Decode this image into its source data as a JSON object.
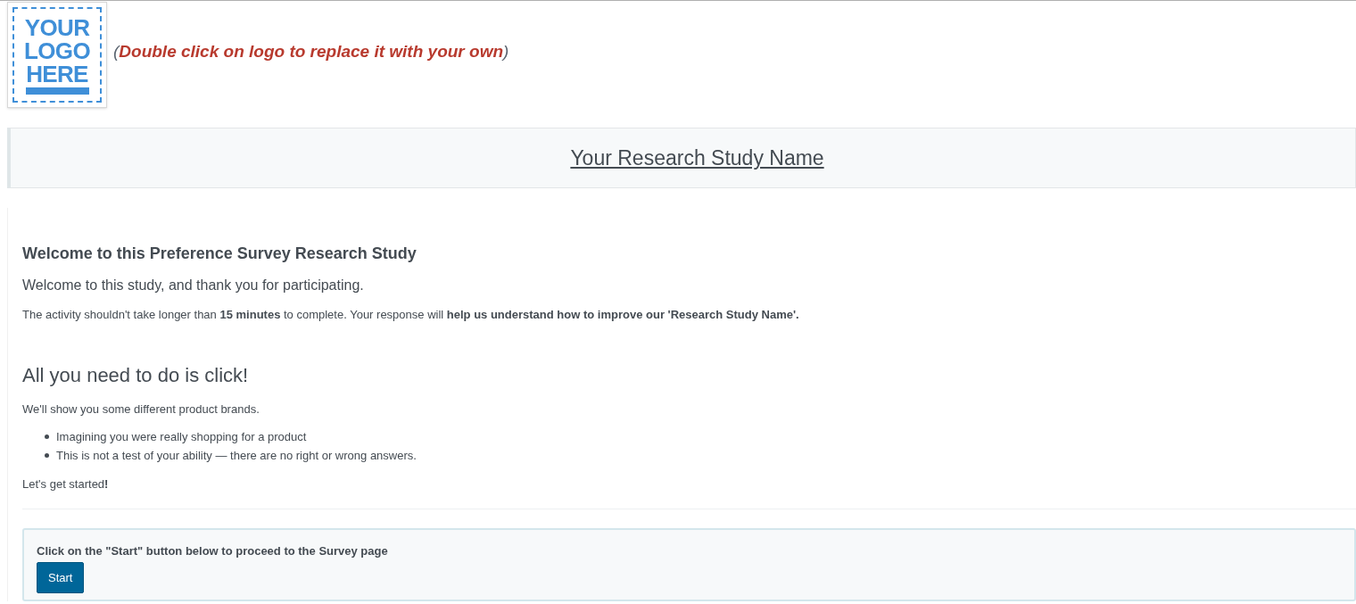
{
  "logo": {
    "lines": [
      "YOUR",
      "LOGO",
      "HERE"
    ]
  },
  "logo_hint": {
    "open": "(",
    "text": "Double click on logo to replace it with your own",
    "close": ")"
  },
  "study_title": "Your Research Study Name",
  "welcome": {
    "heading": "Welcome to this Preference Survey Research Study",
    "lead": "Welcome to this study, and thank you for participating.",
    "body": "The activity shouldn't take longer than **15 minutes** to complete. Your response will **help us understand how to improve our 'Research Study Name'.**"
  },
  "instructions": {
    "heading": "All you need to do is click!",
    "intro": "We'll show you some different product brands.",
    "bullets": [
      "Imagining you were really shopping for a product",
      "This is not a test of your ability — there are no right or wrong answers."
    ],
    "closing": "Let's get started**!**"
  },
  "start_panel": {
    "text": "Click on the \"Start\" button below to proceed to the Survey page",
    "button": "Start"
  }
}
